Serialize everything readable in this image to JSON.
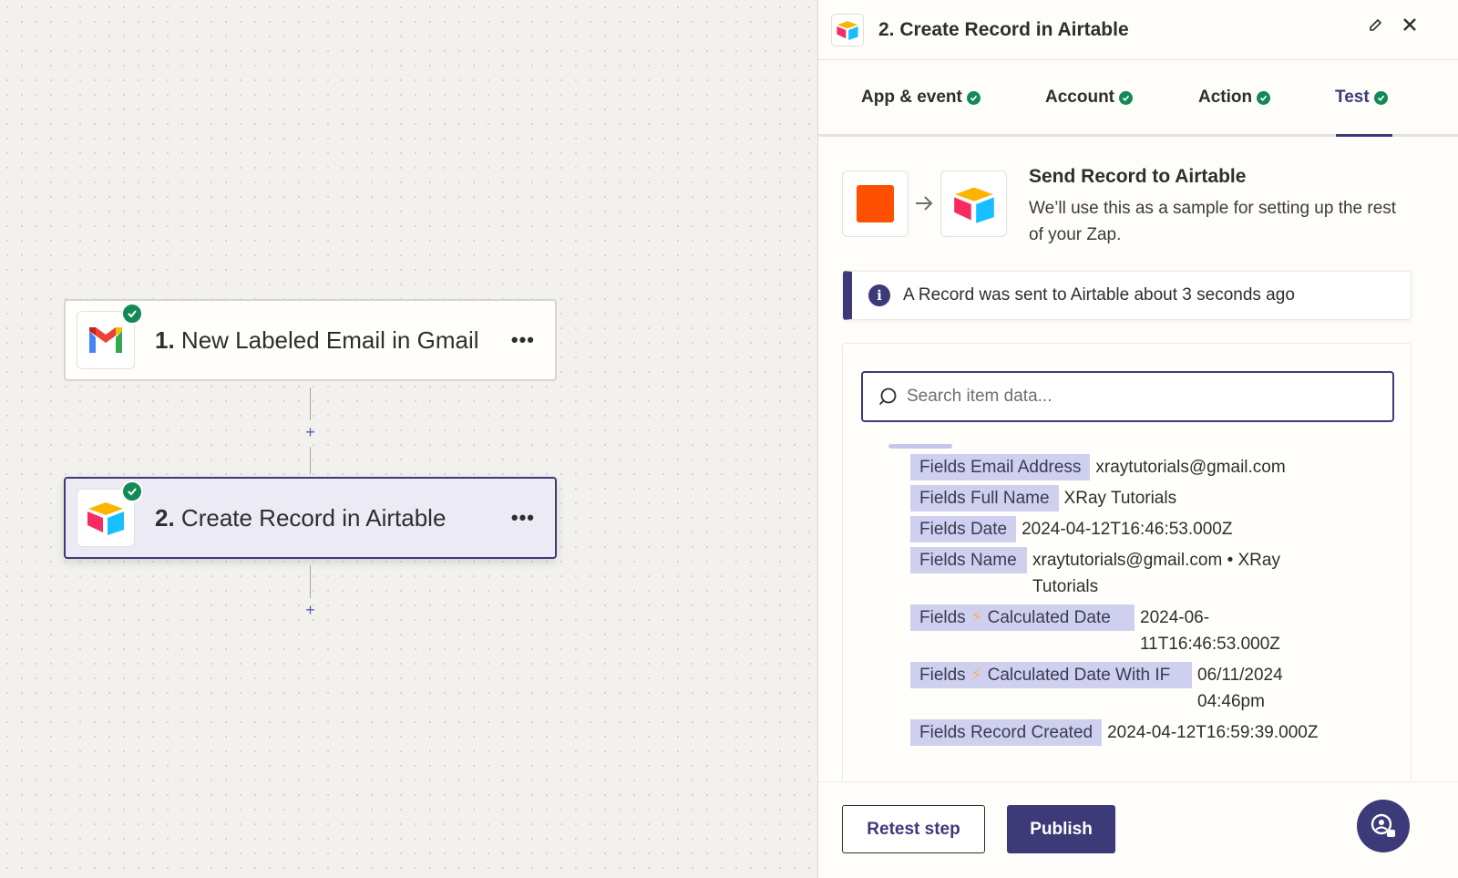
{
  "canvas": {
    "steps": [
      {
        "number": "1.",
        "title": "New Labeled Email in Gmail",
        "app_icon": "gmail-icon",
        "status": "complete",
        "menu": "•••"
      },
      {
        "number": "2.",
        "title": "Create Record in Airtable",
        "app_icon": "airtable-icon",
        "status": "complete",
        "menu": "•••"
      }
    ],
    "add_step_label": "+"
  },
  "panel": {
    "title": "2. Create Record in Airtable",
    "app_icon": "airtable-icon",
    "tabs": [
      {
        "label": "App & event",
        "status": "complete"
      },
      {
        "label": "Account",
        "status": "complete"
      },
      {
        "label": "Action",
        "status": "complete"
      },
      {
        "label": "Test",
        "status": "complete",
        "active": true
      }
    ],
    "send": {
      "title": "Send Record to Airtable",
      "description": "We’ll use this as a sample for setting up the rest of your Zap."
    },
    "info_banner": "A Record was sent to Airtable about 3 seconds ago",
    "search": {
      "placeholder": "Search item data...",
      "value": ""
    },
    "fields": [
      {
        "key": "Fields Email Address",
        "value": "xraytutorials@gmail.com"
      },
      {
        "key": "Fields Full Name",
        "value": "XRay Tutorials"
      },
      {
        "key": "Fields Date",
        "value": "2024-04-12T16:46:53.000Z"
      },
      {
        "key": "Fields Name",
        "value": "xraytutorials@gmail.com • XRay Tutorials"
      },
      {
        "key_prefix": "Fields",
        "key_suffix": "Calculated Date",
        "value": "2024-06-11T16:46:53.000Z"
      },
      {
        "key_prefix": "Fields",
        "key_suffix": "Calculated Date With IF",
        "value": "06/11/2024 04:46pm"
      },
      {
        "key": "Fields Record Created",
        "value": "2024-04-12T16:59:39.000Z"
      }
    ],
    "footer": {
      "retest_label": "Retest step",
      "publish_label": "Publish"
    }
  },
  "colors": {
    "accent": "#3d3a7a",
    "success": "#138a56",
    "field_key_bg": "#cfd0f0",
    "zapier_orange": "#ff4f00"
  }
}
